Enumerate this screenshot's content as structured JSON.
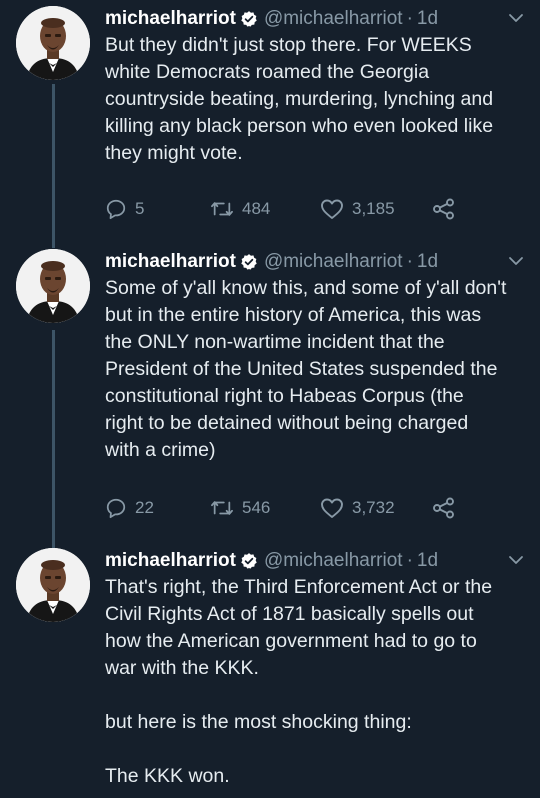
{
  "tweets": [
    {
      "name": "michaelharriot",
      "handle": "@michaelharriot",
      "separator": "·",
      "time": "1d",
      "text": "But they didn't just stop there. For WEEKS\nwhite Democrats roamed the Georgia\ncountryside beating, murdering, lynching and\nkilling any black person who even looked like\nthey might vote.",
      "replies": "5",
      "retweets": "484",
      "likes": "3,185"
    },
    {
      "name": "michaelharriot",
      "handle": "@michaelharriot",
      "separator": "·",
      "time": "1d",
      "text": "Some of y'all know this, and some of y'all don't\nbut in the entire history of America, this was\nthe ONLY non-wartime incident  that the\nPresident of the United States suspended the\nconstitutional right to Habeas Corpus (the\nright to be detained without being charged\nwith a crime)",
      "replies": "22",
      "retweets": "546",
      "likes": "3,732"
    },
    {
      "name": "michaelharriot",
      "handle": "@michaelharriot",
      "separator": "·",
      "time": "1d",
      "text": "That's right, the Third Enforcement Act or the\nCivil Rights Act of 1871 basically spells out\nhow the American government had to go to\nwar with the KKK.\n\nbut here is the most shocking thing:\n\nThe KKK won."
    }
  ],
  "icons": {
    "verified": "verified-badge-icon",
    "more": "chevron-down-icon",
    "reply": "reply-icon",
    "retweet": "retweet-icon",
    "like": "heart-icon",
    "share": "share-icon"
  },
  "colors": {
    "background": "#151f2b",
    "text": "#e6ecf0",
    "secondary": "#8899a6",
    "thread_line": "#3d5466"
  }
}
